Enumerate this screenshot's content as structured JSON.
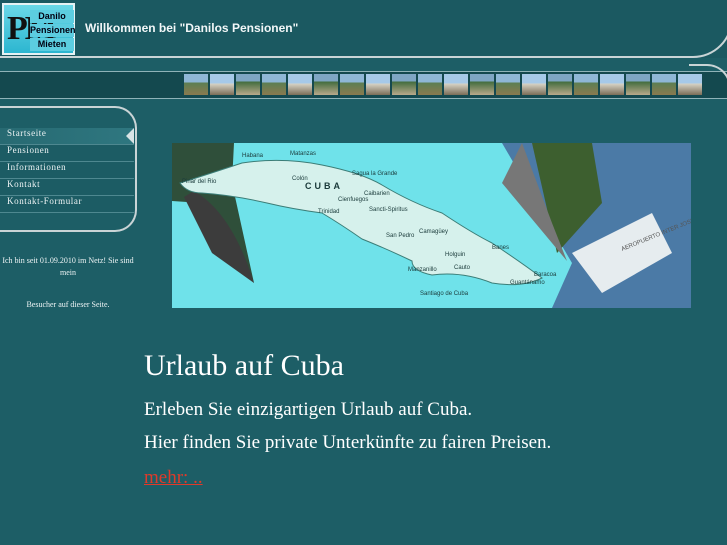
{
  "header": {
    "logo_letters": "PM",
    "logo_words": [
      "Danilo",
      "Pensionen",
      "Mieten"
    ],
    "title": "Willkommen bei  \"Danilos Pensionen\""
  },
  "gallery": {
    "thumb_count": 20
  },
  "menu": {
    "items": [
      {
        "label": "Startseite",
        "active": true
      },
      {
        "label": "Pensionen"
      },
      {
        "label": "Informationen"
      },
      {
        "label": "Kontakt"
      },
      {
        "label": "Kontakt-Formular"
      }
    ]
  },
  "sidebar": {
    "since_text": "Ich bin seit 01.09.2010 im Netz! Sie sind mein",
    "visitors_text": "Besucher auf dieser Seite."
  },
  "map": {
    "country_label": "CUBA",
    "cities": [
      "Habana",
      "Matanzas",
      "Pinar del Rio",
      "Colón",
      "Sagua la Grande",
      "Caibarien",
      "Cienfuegos",
      "Trinidad",
      "Sancti-Spiritus",
      "San Pedro",
      "Camagüey",
      "Holguin",
      "Banes",
      "Manzanillo",
      "Cauto",
      "Baracoa",
      "Guantánamo",
      "Santiago de Cuba"
    ],
    "airport_text": "AEROPUERTO INTER JOSE MARTI"
  },
  "content": {
    "headline": "Urlaub auf Cuba",
    "line1": "Erleben Sie einzigartigen Urlaub auf Cuba.",
    "line2": "Hier finden Sie private Unterkünfte zu fairen Preisen.",
    "more_link": "mehr: .."
  },
  "colors": {
    "background": "#1d5e66",
    "map_sea": "#6fe2ea",
    "link": "#e03a2a"
  }
}
